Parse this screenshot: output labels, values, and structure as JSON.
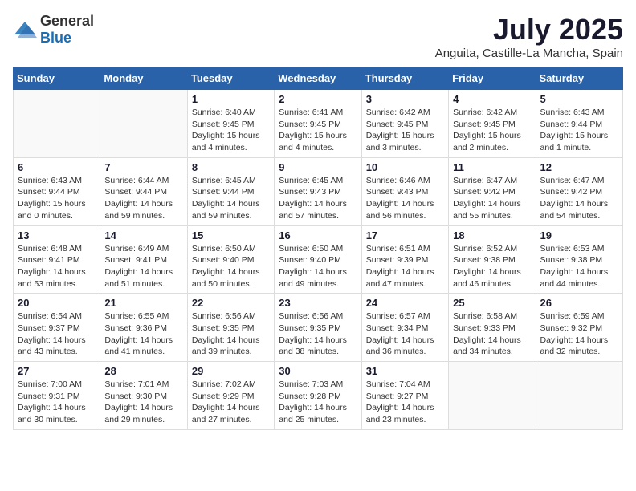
{
  "logo": {
    "general": "General",
    "blue": "Blue"
  },
  "title": "July 2025",
  "location": "Anguita, Castille-La Mancha, Spain",
  "weekdays": [
    "Sunday",
    "Monday",
    "Tuesday",
    "Wednesday",
    "Thursday",
    "Friday",
    "Saturday"
  ],
  "weeks": [
    [
      {
        "day": "",
        "info": ""
      },
      {
        "day": "",
        "info": ""
      },
      {
        "day": "1",
        "info": "Sunrise: 6:40 AM\nSunset: 9:45 PM\nDaylight: 15 hours\nand 4 minutes."
      },
      {
        "day": "2",
        "info": "Sunrise: 6:41 AM\nSunset: 9:45 PM\nDaylight: 15 hours\nand 4 minutes."
      },
      {
        "day": "3",
        "info": "Sunrise: 6:42 AM\nSunset: 9:45 PM\nDaylight: 15 hours\nand 3 minutes."
      },
      {
        "day": "4",
        "info": "Sunrise: 6:42 AM\nSunset: 9:45 PM\nDaylight: 15 hours\nand 2 minutes."
      },
      {
        "day": "5",
        "info": "Sunrise: 6:43 AM\nSunset: 9:44 PM\nDaylight: 15 hours\nand 1 minute."
      }
    ],
    [
      {
        "day": "6",
        "info": "Sunrise: 6:43 AM\nSunset: 9:44 PM\nDaylight: 15 hours\nand 0 minutes."
      },
      {
        "day": "7",
        "info": "Sunrise: 6:44 AM\nSunset: 9:44 PM\nDaylight: 14 hours\nand 59 minutes."
      },
      {
        "day": "8",
        "info": "Sunrise: 6:45 AM\nSunset: 9:44 PM\nDaylight: 14 hours\nand 59 minutes."
      },
      {
        "day": "9",
        "info": "Sunrise: 6:45 AM\nSunset: 9:43 PM\nDaylight: 14 hours\nand 57 minutes."
      },
      {
        "day": "10",
        "info": "Sunrise: 6:46 AM\nSunset: 9:43 PM\nDaylight: 14 hours\nand 56 minutes."
      },
      {
        "day": "11",
        "info": "Sunrise: 6:47 AM\nSunset: 9:42 PM\nDaylight: 14 hours\nand 55 minutes."
      },
      {
        "day": "12",
        "info": "Sunrise: 6:47 AM\nSunset: 9:42 PM\nDaylight: 14 hours\nand 54 minutes."
      }
    ],
    [
      {
        "day": "13",
        "info": "Sunrise: 6:48 AM\nSunset: 9:41 PM\nDaylight: 14 hours\nand 53 minutes."
      },
      {
        "day": "14",
        "info": "Sunrise: 6:49 AM\nSunset: 9:41 PM\nDaylight: 14 hours\nand 51 minutes."
      },
      {
        "day": "15",
        "info": "Sunrise: 6:50 AM\nSunset: 9:40 PM\nDaylight: 14 hours\nand 50 minutes."
      },
      {
        "day": "16",
        "info": "Sunrise: 6:50 AM\nSunset: 9:40 PM\nDaylight: 14 hours\nand 49 minutes."
      },
      {
        "day": "17",
        "info": "Sunrise: 6:51 AM\nSunset: 9:39 PM\nDaylight: 14 hours\nand 47 minutes."
      },
      {
        "day": "18",
        "info": "Sunrise: 6:52 AM\nSunset: 9:38 PM\nDaylight: 14 hours\nand 46 minutes."
      },
      {
        "day": "19",
        "info": "Sunrise: 6:53 AM\nSunset: 9:38 PM\nDaylight: 14 hours\nand 44 minutes."
      }
    ],
    [
      {
        "day": "20",
        "info": "Sunrise: 6:54 AM\nSunset: 9:37 PM\nDaylight: 14 hours\nand 43 minutes."
      },
      {
        "day": "21",
        "info": "Sunrise: 6:55 AM\nSunset: 9:36 PM\nDaylight: 14 hours\nand 41 minutes."
      },
      {
        "day": "22",
        "info": "Sunrise: 6:56 AM\nSunset: 9:35 PM\nDaylight: 14 hours\nand 39 minutes."
      },
      {
        "day": "23",
        "info": "Sunrise: 6:56 AM\nSunset: 9:35 PM\nDaylight: 14 hours\nand 38 minutes."
      },
      {
        "day": "24",
        "info": "Sunrise: 6:57 AM\nSunset: 9:34 PM\nDaylight: 14 hours\nand 36 minutes."
      },
      {
        "day": "25",
        "info": "Sunrise: 6:58 AM\nSunset: 9:33 PM\nDaylight: 14 hours\nand 34 minutes."
      },
      {
        "day": "26",
        "info": "Sunrise: 6:59 AM\nSunset: 9:32 PM\nDaylight: 14 hours\nand 32 minutes."
      }
    ],
    [
      {
        "day": "27",
        "info": "Sunrise: 7:00 AM\nSunset: 9:31 PM\nDaylight: 14 hours\nand 30 minutes."
      },
      {
        "day": "28",
        "info": "Sunrise: 7:01 AM\nSunset: 9:30 PM\nDaylight: 14 hours\nand 29 minutes."
      },
      {
        "day": "29",
        "info": "Sunrise: 7:02 AM\nSunset: 9:29 PM\nDaylight: 14 hours\nand 27 minutes."
      },
      {
        "day": "30",
        "info": "Sunrise: 7:03 AM\nSunset: 9:28 PM\nDaylight: 14 hours\nand 25 minutes."
      },
      {
        "day": "31",
        "info": "Sunrise: 7:04 AM\nSunset: 9:27 PM\nDaylight: 14 hours\nand 23 minutes."
      },
      {
        "day": "",
        "info": ""
      },
      {
        "day": "",
        "info": ""
      }
    ]
  ]
}
